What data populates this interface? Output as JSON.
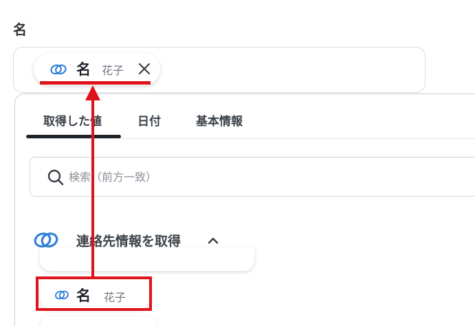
{
  "field": {
    "label": "名"
  },
  "chip": {
    "name": "名",
    "value": "花子",
    "icon": "link-icon",
    "close_icon": "close-icon"
  },
  "tabs": [
    {
      "label": "取得した値",
      "active": true
    },
    {
      "label": "日付",
      "active": false
    },
    {
      "label": "基本情報",
      "active": false
    }
  ],
  "search": {
    "placeholder": "検索（前方一致）",
    "value": ""
  },
  "group": {
    "title": "連絡先情報を取得",
    "icon": "link-icon",
    "expanded": true
  },
  "item": {
    "name": "名",
    "value": "花子",
    "icon": "link-icon"
  },
  "colors": {
    "accent_blue": "#2f7fd8",
    "annotation_red": "#e0121b",
    "tab_active": "#1e232a"
  }
}
